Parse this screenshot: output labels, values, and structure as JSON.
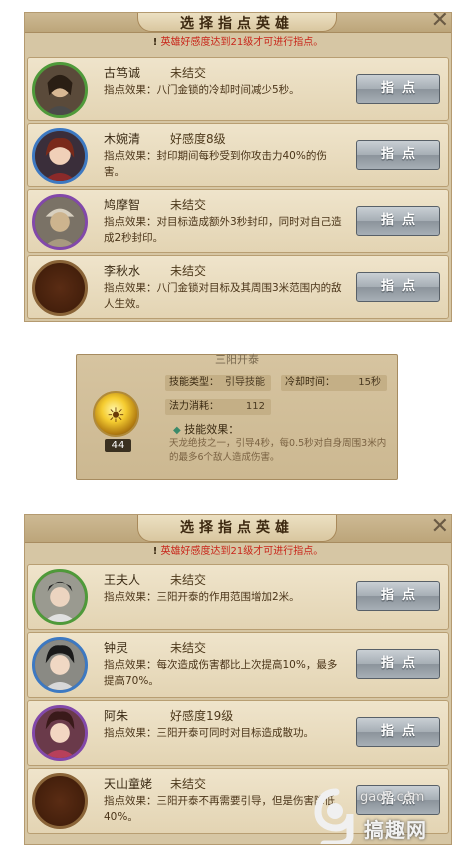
{
  "panel_top": {
    "title": "选择指点英雄",
    "close_symbol": "✕",
    "notice_mark": "!",
    "notice": "英雄好感度达到21级才可进行指点。",
    "heroes": [
      {
        "name": "古笃诚",
        "status": "未结交",
        "effect_label": "指点效果：",
        "effect": "八门金锁的冷却时间减少5秒。",
        "button": "指点",
        "border": "green"
      },
      {
        "name": "木婉清",
        "status": "好感度8级",
        "effect_label": "指点效果：",
        "effect": "封印期间每秒受到你攻击力40%的伤害。",
        "button": "指点",
        "border": "blue"
      },
      {
        "name": "鸠摩智",
        "status": "未结交",
        "effect_label": "指点效果：",
        "effect": "对目标造成额外3秒封印，同时对自己造成2秒封印。",
        "button": "指点",
        "border": "purple"
      },
      {
        "name": "李秋水",
        "status": "未结交",
        "effect_label": "指点效果：",
        "effect": "八门金锁对目标及其周围3米范围内的敌人生效。",
        "button": "指点",
        "border": "empty"
      }
    ]
  },
  "skill_tooltip": {
    "title": "三阳开泰",
    "level": "44",
    "type_label": "技能类型：",
    "type_value": "引导技能",
    "cooldown_label": "冷却时间：",
    "cooldown_value": "15秒",
    "mana_label": "法力消耗：",
    "mana_value": "112",
    "effect_title": "技能效果：",
    "effect_text": "天龙绝技之一，引导4秒，每0.5秒对自身周围3米内的最多6个敌人造成伤害。"
  },
  "panel_bottom": {
    "title": "选择指点英雄",
    "close_symbol": "✕",
    "notice_mark": "!",
    "notice": "英雄好感度达到21级才可进行指点。",
    "heroes": [
      {
        "name": "王夫人",
        "status": "未结交",
        "effect_label": "指点效果：",
        "effect": "三阳开泰的作用范围增加2米。",
        "button": "指点",
        "border": "green"
      },
      {
        "name": "钟灵",
        "status": "未结交",
        "effect_label": "指点效果：",
        "effect": "每次造成伤害都比上次提高10%，最多提高70%。",
        "button": "指点",
        "border": "blue"
      },
      {
        "name": "阿朱",
        "status": "好感度19级",
        "effect_label": "指点效果：",
        "effect": "三阳开泰可同时对目标造成散功。",
        "button": "指点",
        "border": "purple"
      },
      {
        "name": "天山童姥",
        "status": "未结交",
        "effect_label": "指点效果：",
        "effect": "三阳开泰不再需要引导，但是伤害降低40%。",
        "button": "指点",
        "border": "empty"
      }
    ]
  },
  "watermark": {
    "site": "gao7.com",
    "brand": "搞趣网"
  }
}
